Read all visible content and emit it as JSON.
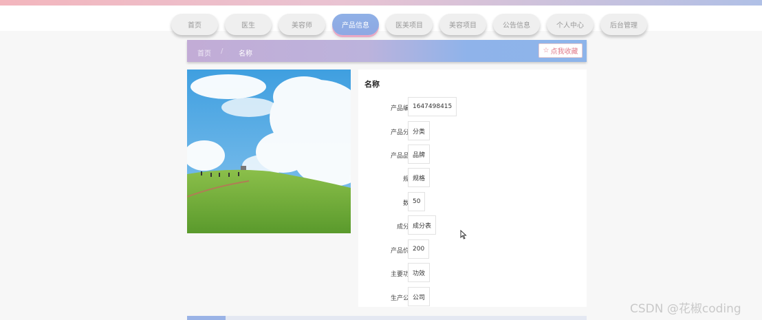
{
  "nav": {
    "items": [
      {
        "label": "首页"
      },
      {
        "label": "医生"
      },
      {
        "label": "美容师"
      },
      {
        "label": "产品信息"
      },
      {
        "label": "医美项目"
      },
      {
        "label": "美容项目"
      },
      {
        "label": "公告信息"
      },
      {
        "label": "个人中心"
      },
      {
        "label": "后台管理"
      }
    ],
    "active_index": 3
  },
  "breadcrumb": {
    "home": "首页",
    "separator": "/",
    "current": "名称",
    "favorite_label": "点我收藏",
    "favorite_icon": "star-outline-icon"
  },
  "product": {
    "title": "名称",
    "fields": [
      {
        "label": "产品编号：",
        "value": "1647498415"
      },
      {
        "label": "产品分类：",
        "value": "分类"
      },
      {
        "label": "产品品牌：",
        "value": "品牌"
      },
      {
        "label": "规格：",
        "value": "规格"
      },
      {
        "label": "数量：",
        "value": "50"
      },
      {
        "label": "成分表：",
        "value": "成分表"
      },
      {
        "label": "产品价格：",
        "value": "200"
      },
      {
        "label": "主要功效：",
        "value": "功效"
      },
      {
        "label": "生产公司：",
        "value": "公司"
      }
    ]
  },
  "watermark": "CSDN @花椒coding",
  "colors": {
    "accent_blue": "#8db4ea",
    "accent_purple": "#c2acd6",
    "favorite_pink": "#e07a8a"
  }
}
